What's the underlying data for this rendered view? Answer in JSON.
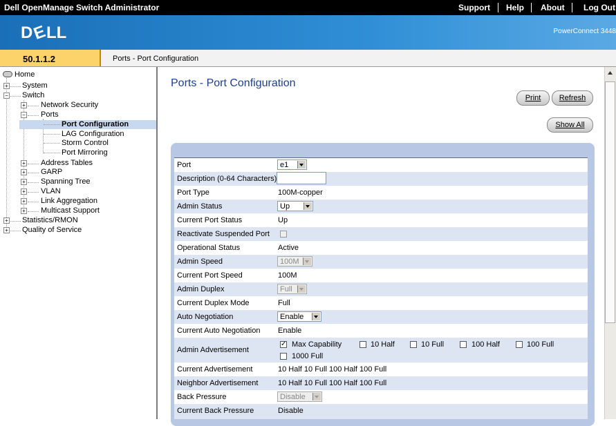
{
  "topbar": {
    "title": "Dell OpenManage Switch Administrator",
    "links": [
      "Support",
      "Help",
      "About",
      "Log Out"
    ]
  },
  "banner": {
    "product": "PowerConnect 3448"
  },
  "address": {
    "ip": "50.1.1.2",
    "breadcrumb": "Ports - Port Configuration"
  },
  "tree": {
    "items": [
      "Home",
      "System",
      "Switch",
      "Network Security",
      "Ports",
      "Port Configuration",
      "LAG Configuration",
      "Storm Control",
      "Port Mirroring",
      "Address Tables",
      "GARP",
      "Spanning Tree",
      "VLAN",
      "Link Aggregation",
      "Multicast Support",
      "Statistics/RMON",
      "Quality of Service"
    ]
  },
  "main": {
    "title": "Ports - Port Configuration",
    "print_label": "Print",
    "refresh_label": "Refresh",
    "show_all_label": "Show All"
  },
  "form": {
    "port": {
      "label": "Port",
      "value": "e1"
    },
    "description": {
      "label": "Description (0-64 Characters)",
      "value": ""
    },
    "port_type": {
      "label": "Port Type",
      "value": "100M-copper"
    },
    "admin_status": {
      "label": "Admin Status",
      "value": "Up"
    },
    "current_port_status": {
      "label": "Current Port Status",
      "value": "Up"
    },
    "reactivate": {
      "label": "Reactivate Suspended Port",
      "checked": false
    },
    "operational_status": {
      "label": "Operational Status",
      "value": "Active"
    },
    "admin_speed": {
      "label": "Admin Speed",
      "value": "100M"
    },
    "current_port_speed": {
      "label": "Current Port Speed",
      "value": "100M"
    },
    "admin_duplex": {
      "label": "Admin Duplex",
      "value": "Full"
    },
    "current_duplex": {
      "label": "Current Duplex Mode",
      "value": "Full"
    },
    "auto_negotiation": {
      "label": "Auto Negotiation",
      "value": "Enable"
    },
    "current_auto_neg": {
      "label": "Current Auto Negotiation",
      "value": "Enable"
    },
    "admin_advertisement": {
      "label": "Admin Advertisement",
      "options": [
        {
          "label": "Max Capability",
          "checked": true
        },
        {
          "label": "10 Half",
          "checked": false
        },
        {
          "label": "10 Full",
          "checked": false
        },
        {
          "label": "100 Half",
          "checked": false
        },
        {
          "label": "100 Full",
          "checked": false
        },
        {
          "label": "1000 Full",
          "checked": false
        }
      ]
    },
    "current_advertisement": {
      "label": "Current Advertisement",
      "value": "10 Half 10 Full 100 Half 100 Full"
    },
    "neighbor_advertisement": {
      "label": "Neighbor Advertisement",
      "value": "10 Half 10 Full 100 Half 100 Full"
    },
    "back_pressure": {
      "label": "Back Pressure",
      "value": "Disable"
    },
    "current_back_pressure": {
      "label": "Current Back Pressure",
      "value": "Disable"
    }
  }
}
